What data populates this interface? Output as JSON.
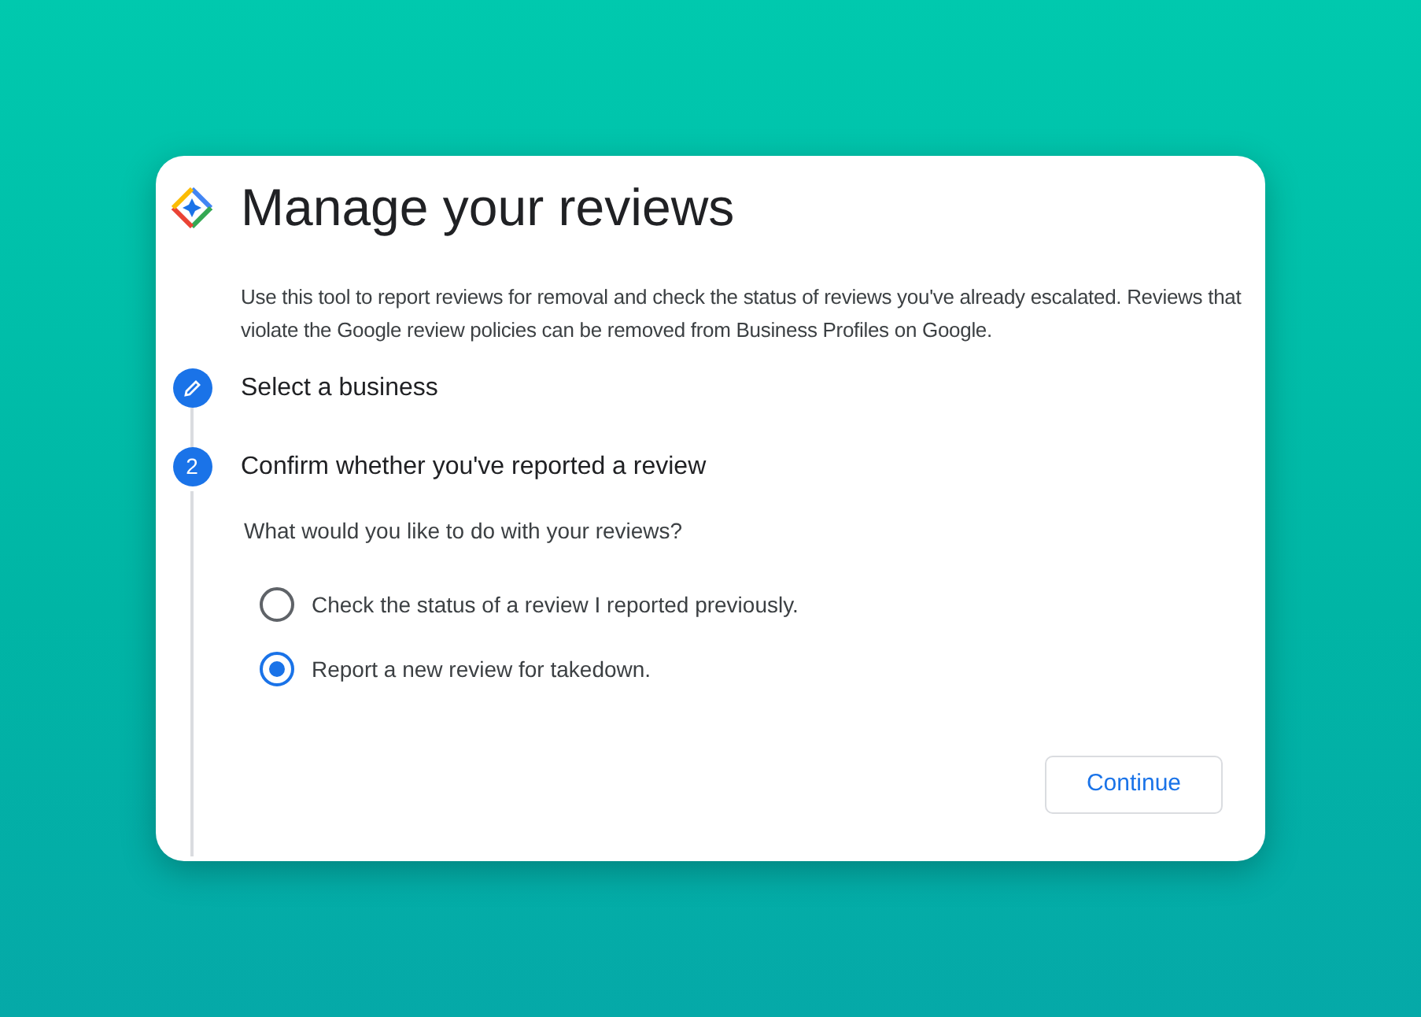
{
  "title": "Manage your reviews",
  "description": "Use this tool to report reviews for removal and check the status of reviews you've already escalated. Reviews that violate the Google review policies can be removed from Business Profiles on Google.",
  "steps": [
    {
      "kind": "done",
      "label": "Select a business"
    },
    {
      "kind": "number",
      "number": "2",
      "label": "Confirm whether you've reported a review",
      "question": "What would you like to do with your reviews?",
      "options": [
        {
          "label": "Check the status of a review I reported previously.",
          "selected": false
        },
        {
          "label": "Report a new review for takedown.",
          "selected": true
        }
      ]
    }
  ],
  "buttons": [
    "Continue"
  ]
}
